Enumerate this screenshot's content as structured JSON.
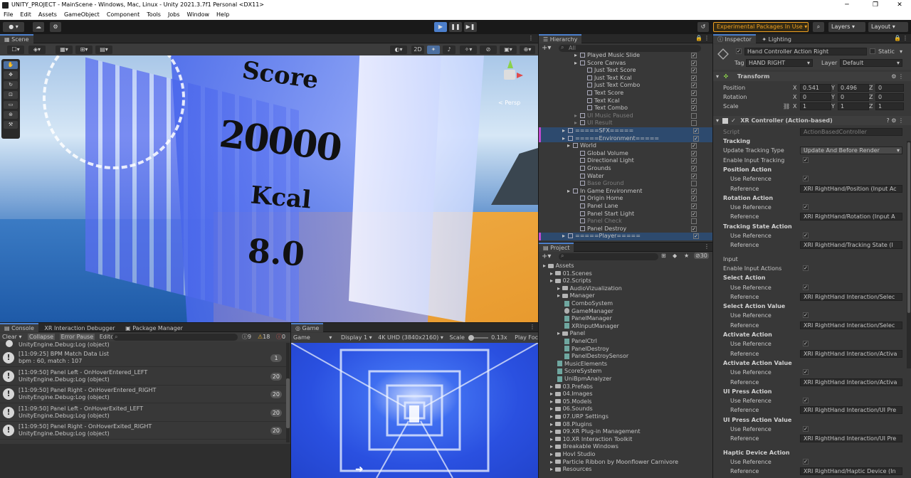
{
  "title": "UNITY_PROJECT - MainScene - Windows, Mac, Linux - Unity 2021.3.7f1 Personal <DX11>",
  "menu": [
    "File",
    "Edit",
    "Assets",
    "GameObject",
    "Component",
    "Tools",
    "Jobs",
    "Window",
    "Help"
  ],
  "toolbar": {
    "experimental": "Experimental Packages In Use",
    "layers": "Layers",
    "layout": "Layout"
  },
  "scene": {
    "tab": "Scene",
    "mode2d": "2D",
    "persp": "< Persp",
    "score_label": "Score",
    "score_value": "20000",
    "kcal_label": "Kcal",
    "kcal_value": "8.0"
  },
  "hierarchy": {
    "tab": "Hierarchy",
    "search": "All",
    "items": [
      {
        "name": "Played Music Slide",
        "dim": false,
        "indent": 3
      },
      {
        "name": "Score Canvas",
        "dim": false,
        "indent": 3
      },
      {
        "name": "Just Text Score",
        "dim": false,
        "indent": 4
      },
      {
        "name": "Just Text Kcal",
        "dim": false,
        "indent": 4
      },
      {
        "name": "Just Text Combo",
        "dim": false,
        "indent": 4
      },
      {
        "name": "Text Score",
        "dim": false,
        "indent": 4
      },
      {
        "name": "Text Kcal",
        "dim": false,
        "indent": 4
      },
      {
        "name": "Text Combo",
        "dim": false,
        "indent": 4
      },
      {
        "name": "UI Music Paused",
        "dim": true,
        "indent": 3
      },
      {
        "name": "UI Result",
        "dim": true,
        "indent": 3
      },
      {
        "name": "=====SFX=====",
        "dim": false,
        "indent": 1
      },
      {
        "name": "=====Environment=====",
        "dim": false,
        "indent": 1
      },
      {
        "name": "World",
        "dim": false,
        "indent": 2
      },
      {
        "name": "Global Volume",
        "dim": false,
        "indent": 3
      },
      {
        "name": "Directional Light",
        "dim": false,
        "indent": 3
      },
      {
        "name": "Grounds",
        "dim": false,
        "indent": 3
      },
      {
        "name": "Water",
        "dim": false,
        "indent": 3
      },
      {
        "name": "Base Ground",
        "dim": true,
        "indent": 3
      },
      {
        "name": "In Game Environment",
        "dim": false,
        "indent": 2
      },
      {
        "name": "Origin Home",
        "dim": false,
        "indent": 3
      },
      {
        "name": "Panel Lane",
        "dim": false,
        "indent": 3
      },
      {
        "name": "Panel Start Light",
        "dim": false,
        "indent": 3
      },
      {
        "name": "Panel Check",
        "dim": true,
        "indent": 3
      },
      {
        "name": "Panel Destroy",
        "dim": false,
        "indent": 3
      },
      {
        "name": "=====Player=====",
        "dim": false,
        "indent": 1
      }
    ]
  },
  "project": {
    "tab": "Project",
    "count": "30",
    "items": [
      {
        "name": "Assets",
        "type": "folder",
        "indent": 0
      },
      {
        "name": "01.Scenes",
        "type": "folder",
        "indent": 1
      },
      {
        "name": "02.Scripts",
        "type": "folder",
        "indent": 1
      },
      {
        "name": "AudioVizualization",
        "type": "folder",
        "indent": 2
      },
      {
        "name": "Manager",
        "type": "folder",
        "indent": 2
      },
      {
        "name": "ComboSystem",
        "type": "script",
        "indent": 3
      },
      {
        "name": "GameManager",
        "type": "gear",
        "indent": 3
      },
      {
        "name": "PanelManager",
        "type": "script",
        "indent": 3
      },
      {
        "name": "XRInputManager",
        "type": "script",
        "indent": 3
      },
      {
        "name": "Panel",
        "type": "folder",
        "indent": 2
      },
      {
        "name": "PanelCtrl",
        "type": "script",
        "indent": 3
      },
      {
        "name": "PanelDestroy",
        "type": "script",
        "indent": 3
      },
      {
        "name": "PanelDestroySensor",
        "type": "script",
        "indent": 3
      },
      {
        "name": "MusicElements",
        "type": "script",
        "indent": 2
      },
      {
        "name": "ScoreSystem",
        "type": "script",
        "indent": 2
      },
      {
        "name": "UniBpmAnalyzer",
        "type": "script",
        "indent": 2
      },
      {
        "name": "03.Prefabs",
        "type": "folder",
        "indent": 1
      },
      {
        "name": "04.Images",
        "type": "folder",
        "indent": 1
      },
      {
        "name": "05.Models",
        "type": "folder",
        "indent": 1
      },
      {
        "name": "06.Sounds",
        "type": "folder",
        "indent": 1
      },
      {
        "name": "07.URP Settings",
        "type": "folder",
        "indent": 1
      },
      {
        "name": "08.Plugins",
        "type": "folder",
        "indent": 1
      },
      {
        "name": "09.XR Plug-in Management",
        "type": "folder",
        "indent": 1
      },
      {
        "name": "10.XR Interaction Toolkit",
        "type": "folder",
        "indent": 1
      },
      {
        "name": "Breakable Windows",
        "type": "folder",
        "indent": 1
      },
      {
        "name": "Hovl Studio",
        "type": "folder",
        "indent": 1
      },
      {
        "name": "Particle Ribbon by Moonflower Carnivore",
        "type": "folder",
        "indent": 1
      },
      {
        "name": "Resources",
        "type": "folder",
        "indent": 1
      }
    ]
  },
  "inspector": {
    "tab": "Inspector",
    "tab2": "Lighting",
    "object_name": "Hand Controller Action Right",
    "static": "Static",
    "tag_label": "Tag",
    "tag": "HAND RIGHT",
    "layer_label": "Layer",
    "layer": "Default",
    "transform": "Transform",
    "position_label": "Position",
    "rotation_label": "Rotation",
    "scale_label": "Scale",
    "position": {
      "x": "0.541",
      "y": "0.496",
      "z": "0"
    },
    "rotation": {
      "x": "0",
      "y": "0",
      "z": "0"
    },
    "scale": {
      "x": "1",
      "y": "1",
      "z": "1"
    },
    "component": "XR Controller (Action-based)",
    "script_label": "Script",
    "script": "ActionBasedController",
    "rows": [
      {
        "kind": "head",
        "label": "Tracking"
      },
      {
        "kind": "select",
        "label": "Update Tracking Type",
        "value": "Update And Before Render"
      },
      {
        "kind": "check",
        "label": "Enable Input Tracking"
      },
      {
        "kind": "head",
        "label": "Position Action"
      },
      {
        "kind": "check",
        "label": "Use Reference",
        "sub": true
      },
      {
        "kind": "ref",
        "label": "Reference",
        "value": "XRI RightHand/Position (Input Ac",
        "sub": true
      },
      {
        "kind": "head",
        "label": "Rotation Action"
      },
      {
        "kind": "check",
        "label": "Use Reference",
        "sub": true
      },
      {
        "kind": "ref",
        "label": "Reference",
        "value": "XRI RightHand/Rotation (Input A",
        "sub": true
      },
      {
        "kind": "head",
        "label": "Tracking State Action"
      },
      {
        "kind": "check",
        "label": "Use Reference",
        "sub": true
      },
      {
        "kind": "ref",
        "label": "Reference",
        "value": "XRI RightHand/Tracking State (I",
        "sub": true
      },
      {
        "kind": "gap"
      },
      {
        "kind": "plain",
        "label": "Input"
      },
      {
        "kind": "check",
        "label": "Enable Input Actions"
      },
      {
        "kind": "head",
        "label": "Select Action"
      },
      {
        "kind": "check",
        "label": "Use Reference",
        "sub": true
      },
      {
        "kind": "ref",
        "label": "Reference",
        "value": "XRI RightHand Interaction/Selec",
        "sub": true
      },
      {
        "kind": "head",
        "label": "Select Action Value"
      },
      {
        "kind": "check",
        "label": "Use Reference",
        "sub": true
      },
      {
        "kind": "ref",
        "label": "Reference",
        "value": "XRI RightHand Interaction/Selec",
        "sub": true
      },
      {
        "kind": "head",
        "label": "Activate Action"
      },
      {
        "kind": "check",
        "label": "Use Reference",
        "sub": true
      },
      {
        "kind": "ref",
        "label": "Reference",
        "value": "XRI RightHand Interaction/Activa",
        "sub": true
      },
      {
        "kind": "head",
        "label": "Activate Action Value"
      },
      {
        "kind": "check",
        "label": "Use Reference",
        "sub": true
      },
      {
        "kind": "ref",
        "label": "Reference",
        "value": "XRI RightHand Interaction/Activa",
        "sub": true
      },
      {
        "kind": "head",
        "label": "UI Press Action"
      },
      {
        "kind": "check",
        "label": "Use Reference",
        "sub": true
      },
      {
        "kind": "ref",
        "label": "Reference",
        "value": "XRI RightHand Interaction/UI Pre",
        "sub": true
      },
      {
        "kind": "head",
        "label": "UI Press Action Value"
      },
      {
        "kind": "check",
        "label": "Use Reference",
        "sub": true
      },
      {
        "kind": "ref",
        "label": "Reference",
        "value": "XRI RightHand Interaction/UI Pre",
        "sub": true
      },
      {
        "kind": "gap"
      },
      {
        "kind": "head",
        "label": "Haptic Device Action"
      },
      {
        "kind": "check",
        "label": "Use Reference",
        "sub": true
      },
      {
        "kind": "ref",
        "label": "Reference",
        "value": "XRI RightHand/Haptic Device (In",
        "sub": true
      }
    ]
  },
  "console": {
    "tabs": [
      "Console",
      "XR Interaction Debugger",
      "Package Manager"
    ],
    "clear": "Clear",
    "collapse": "Collapse",
    "error_pause": "Error Pause",
    "editor": "Editor",
    "count_info": "9",
    "count_warn": "18",
    "count_err": "0",
    "top_line": "UnityEngine.Debug:Log (object)",
    "entries": [
      {
        "l1": "[11:09:25] BPM Match Data List",
        "l2": "bpm : 60, match : 107",
        "count": "1"
      },
      {
        "l1": "[11:09:50] Panel Left - OnHoverEntered_LEFT",
        "l2": "UnityEngine.Debug:Log (object)",
        "count": "20"
      },
      {
        "l1": "[11:09:50] Panel Right - OnHoverEntered_RIGHT",
        "l2": "UnityEngine.Debug:Log (object)",
        "count": "20"
      },
      {
        "l1": "[11:09:50] Panel Left - OnHoverExited_LEFT",
        "l2": "UnityEngine.Debug:Log (object)",
        "count": "20"
      },
      {
        "l1": "[11:09:50] Panel Right - OnHoverExited_RIGHT",
        "l2": "UnityEngine.Debug:Log (object)",
        "count": "20"
      }
    ]
  },
  "game": {
    "tab": "Game",
    "mode": "Game",
    "display": "Display 1",
    "resolution": "4K UHD (3840x2160)",
    "scale_label": "Scale",
    "scale": "0.13x",
    "play_focus": "Play Focu"
  }
}
